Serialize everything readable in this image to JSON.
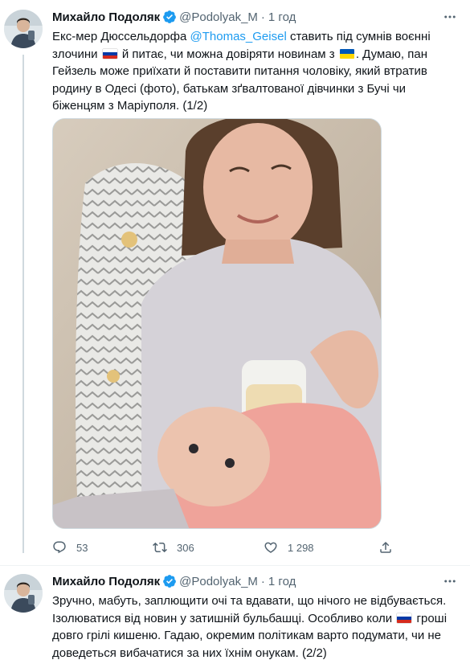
{
  "tweets": [
    {
      "author_name": "Михайло Подоляк",
      "handle": "@Podolyak_M",
      "separator": "·",
      "time": "1 год",
      "text_seg1": "Екс-мер Дюссельдорфа ",
      "mention": "@Thomas_Geisel",
      "text_seg2": " ставить під сумнів воєнні злочини ",
      "text_seg3": " й питає, чи можна довіряти новинам з ",
      "text_seg4": ". Думаю, пан Гейзель може приїхати й поставити питання чоловіку, який втратив родину в Одесі (фото), батькам зґвалтованої дівчинки з Бучі чи біженцям з Маріуполя. (1/2)",
      "replies": "53",
      "retweets": "306",
      "likes": "1 298"
    },
    {
      "author_name": "Михайло Подоляк",
      "handle": "@Podolyak_M",
      "separator": "·",
      "time": "1 год",
      "text_seg1": "Зручно, мабуть, заплющити очі та вдавати, що нічого не відбувається. Ізолюватися від новин у затишній бульбашці. Особливо коли ",
      "text_seg2": " гроші довго грілі кишеню. Гадаю, окремим політикам варто подумати, чи не доведеться вибачатися за них їхнім онукам. (2/2)"
    }
  ],
  "icons": {
    "verified": "verified-badge-icon",
    "more": "more-dots-icon",
    "reply": "reply-icon",
    "retweet": "retweet-icon",
    "like": "heart-icon",
    "share": "share-icon",
    "flag_ru": "russia-flag-icon",
    "flag_ua": "ukraine-flag-icon"
  },
  "colors": {
    "accent": "#1d9bf0",
    "text": "#0f1419",
    "secondary": "#536471"
  }
}
